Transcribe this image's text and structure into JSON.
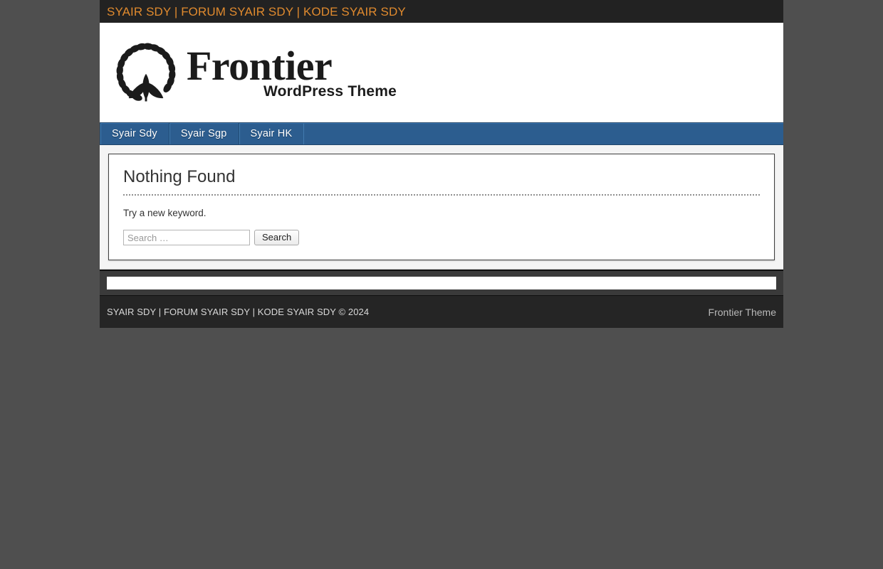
{
  "topbar": {
    "title": "SYAIR SDY | FORUM SYAIR SDY | KODE SYAIR SDY",
    "accent_color": "#e08a2e",
    "background_color": "#222222"
  },
  "header": {
    "logo": {
      "icon": "laurel-wreath-leaf-emblem",
      "name": "Frontier",
      "subtitle": "WordPress Theme"
    },
    "background_color": "#ffffff"
  },
  "nav": {
    "background_color": "#2c5d8f",
    "items": [
      {
        "label": "Syair Sdy"
      },
      {
        "label": "Syair Sgp"
      },
      {
        "label": "Syair HK"
      }
    ]
  },
  "main": {
    "title": "Nothing Found",
    "message": "Try a new keyword.",
    "search": {
      "placeholder": "Search …",
      "value": "",
      "button_label": "Search"
    }
  },
  "footer_widgets": {
    "background_color": "#3a3a3a",
    "widgets": [
      {
        "name": "empty-widget",
        "content": ""
      }
    ]
  },
  "footer": {
    "background_color": "#252525",
    "copyright": "SYAIR SDY | FORUM SYAIR SDY | KODE SYAIR SDY © 2024",
    "credit": "Frontier Theme"
  },
  "page": {
    "background_color": "#4f4f4f"
  }
}
